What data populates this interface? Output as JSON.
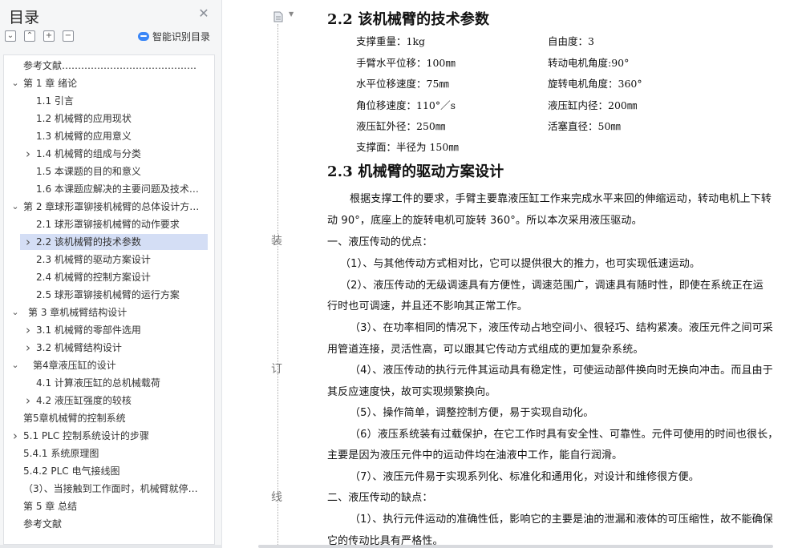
{
  "sidebar": {
    "title": "目录",
    "close_glyph": "✕",
    "tools": [
      {
        "icon": "collapse-all-icon",
        "glyph": "⌄"
      },
      {
        "icon": "expand-all-icon",
        "glyph": "⌃"
      },
      {
        "icon": "plus-icon",
        "glyph": "+"
      },
      {
        "icon": "minus-icon",
        "glyph": "−"
      }
    ],
    "ai_label": "智能识别目录",
    "toc": [
      {
        "label": "参考文献……………………………………………………"
      },
      {
        "label": "第 1 章  绪论"
      },
      {
        "label": "1.1 引言"
      },
      {
        "label": "1.2  机械臂的应用现状"
      },
      {
        "label": "1.3  机械臂的应用意义"
      },
      {
        "label": "1.4 机械臂的组成与分类"
      },
      {
        "label": "1.5 本课题的目的和意义"
      },
      {
        "label": "1.6  本课题应解决的主要问题及技术…"
      },
      {
        "label": "第 2 章球形罩铆接机械臂的总体设计方…"
      },
      {
        "label": "2.1  球形罩铆接机械臂的动作要求"
      },
      {
        "label": "2.2 该机械臂的技术参数"
      },
      {
        "label": "2.3 机械臂的驱动方案设计"
      },
      {
        "label": "2.4 机械臂的控制方案设计"
      },
      {
        "label": "2.5 球形罩铆接机械臂的运行方案"
      },
      {
        "label": "第 3 章机械臂结构设计"
      },
      {
        "label": "3.1 机械臂的零部件选用"
      },
      {
        "label": "3.2 机械臂结构设计"
      },
      {
        "label": "第4章液压缸的设计"
      },
      {
        "label": "4.1 计算液压缸的总机械载荷"
      },
      {
        "label": "4.2 液压缸强度的较核"
      },
      {
        "label": "第5章机械臂的控制系统"
      },
      {
        "label": "5.1 PLC 控制系统设计的步骤"
      },
      {
        "label": "5.4.1  系统原理图"
      },
      {
        "label": "5.4.2 PLC 电气接线图"
      },
      {
        "label": "（3）、当接触到工作面时，机械臂就停…"
      },
      {
        "label": "第 5 章  总结"
      },
      {
        "label": "参考文献"
      }
    ]
  },
  "document": {
    "binding_marks": [
      "装",
      "订",
      "线"
    ],
    "h_params": "2.2 该机械臂的技术参数",
    "params": [
      "支撑重量：1kg",
      "自由度：3",
      "手臂水平位移：100㎜",
      "转动电机角度:90°",
      "水平位移速度：75㎜",
      "旋转电机角度：360°",
      "角位移速度：110°／s",
      "液压缸内径：200㎜",
      "液压缸外径：250㎜",
      "活塞直径：50㎜",
      "支撑面：半径为 150㎜"
    ],
    "h_drive": "2.3 机械臂的驱动方案设计",
    "lines": [
      "根据支撑工件的要求，手臂主要靠液压缸工作来完成水平来回的伸缩运动，转动电机上下转",
      "动 90°，底座上的旋转电机可旋转 360°。所以本次采用液压驱动。",
      "一、液压传动的优点：",
      "（1）、与其他传动方式相对比，它可以提供很大的推力，也可实现低速运动。",
      "（2）、液压传动的无级调速具有方便性，调速范围广，调速具有随时性，即使在系统正在运",
      "行时也可调速，并且还不影响其正常工作。",
      "（3）、在功率相同的情况下，液压传动占地空间小、很轻巧、结构紧凑。液压元件之间可采",
      "用管道连接，灵活性高，可以跟其它传动方式组成的更加复杂系统。",
      "（4）、液压传动的执行元件其运动具有稳定性，可使运动部件换向时无换向冲击。而且由于",
      "其反应速度快，故可实现频繁换向。",
      "（5）、操作简单，调整控制方便，易于实现自动化。",
      "（6）液压系统装有过载保护，在它工作时具有安全性、可靠性。元件可使用的时间也很长，",
      "主要是因为液压元件中的运动件均在油液中工作，能自行润滑。",
      "（7）、液压元件易于实现系列化、标准化和通用化，对设计和维修很方便。",
      "二、液压传动的缺点：",
      "（1）、执行元件运动的准确性低，影响它的主要是油的泄漏和液体的可压缩性，故不能确保",
      "它的传动比具有严格性。"
    ]
  }
}
